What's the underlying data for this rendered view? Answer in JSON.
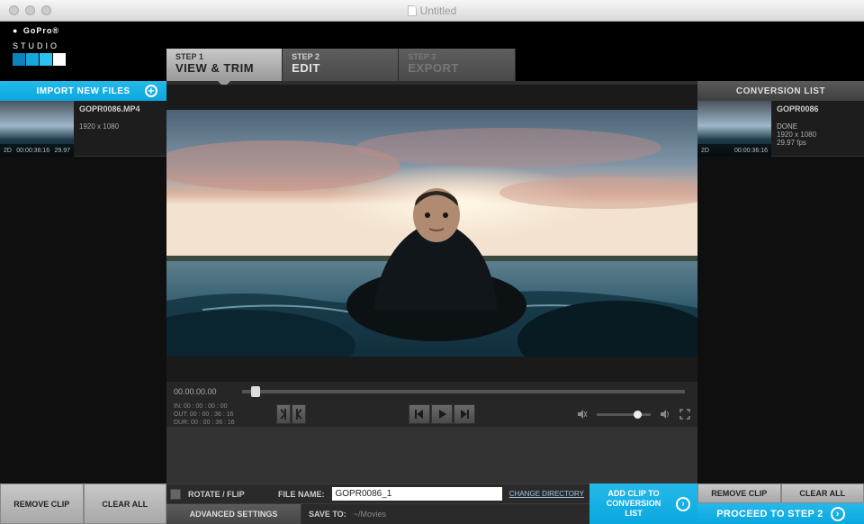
{
  "window": {
    "title": "Untitled"
  },
  "logo": {
    "brand": "GoPro",
    "sub": "STUDIO",
    "colors": [
      "#0a84bf",
      "#16a7dc",
      "#2bc2f2",
      "#ffffff"
    ]
  },
  "steps": [
    {
      "num": "STEP 1",
      "title": "VIEW & TRIM",
      "state": "active"
    },
    {
      "num": "STEP 2",
      "title": "EDIT",
      "state": "normal"
    },
    {
      "num": "STEP 3",
      "title": "EXPORT",
      "state": "inactive"
    }
  ],
  "left": {
    "import_label": "IMPORT NEW FILES",
    "clip": {
      "filename": "GOPR0086.MP4",
      "resolution": "1920 x 1080",
      "badge": "2D",
      "duration": "00:00:36:16",
      "fps": "29.97"
    },
    "remove": "REMOVE CLIP",
    "clear": "CLEAR ALL"
  },
  "right": {
    "title": "CONVERSION LIST",
    "clip": {
      "filename": "GOPR0086",
      "status": "DONE",
      "resolution": "1920 x 1080",
      "fps": "29.97 fps",
      "badge": "2D",
      "duration": "00:00:36:16"
    },
    "remove": "REMOVE CLIP",
    "clear": "CLEAR ALL",
    "proceed": "PROCEED TO STEP 2"
  },
  "timeline": {
    "tc": "00.00.00.00"
  },
  "io": {
    "in": "IN:  00 : 00 : 00 : 00",
    "out": "OUT: 00 : 00 : 36 : 16",
    "dur": "DUR: 00 : 00 : 36 : 16"
  },
  "bottom": {
    "rotate": "ROTATE / FLIP",
    "filename_label": "FILE NAME:",
    "filename_value": "GOPR0086_1",
    "change_dir": "CHANGE DIRECTORY",
    "advanced": "ADVANCED SETTINGS",
    "saveto_label": "SAVE TO:",
    "saveto_value": "~/Movies",
    "addclip": "ADD CLIP TO CONVERSION LIST"
  }
}
